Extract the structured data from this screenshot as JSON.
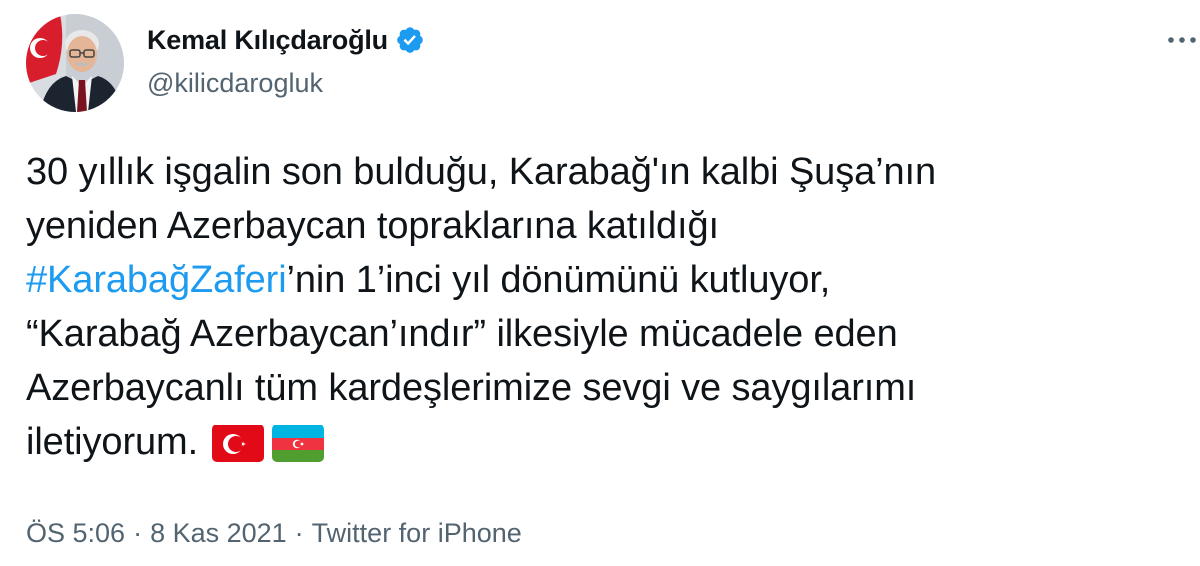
{
  "author": {
    "display_name": "Kemal Kılıçdaroğlu",
    "handle": "@kilicdarogluk",
    "verified": true,
    "avatar_icon": "profile-photo",
    "verified_icon": "verified-badge-icon"
  },
  "more_icon": "more-options-icon",
  "tweet": {
    "line1": "30 yıllık işgalin son bulduğu, Karabağ'ın kalbi Şuşa’nın",
    "line2": "yeniden Azerbaycan topraklarına katıldığı",
    "hashtag": "#KarabağZaferi",
    "line3_rest": "’nin 1’inci yıl dönümünü kutluyor,",
    "line4": "“Karabağ Azerbaycan’ındır” ilkesiyle mücadele eden",
    "line5": "Azerbaycanlı tüm kardeşlerimize sevgi ve saygılarımı",
    "line6": "iletiyorum.",
    "emoji": [
      "turkey-flag",
      "azerbaijan-flag"
    ]
  },
  "meta": {
    "time": "ÖS 5:06",
    "separator": "·",
    "date": "8 Kas 2021",
    "source": "Twitter for iPhone"
  },
  "colors": {
    "text": "#0f1419",
    "secondary": "#536471",
    "link": "#1d9bf0",
    "verified": "#1d9bf0"
  }
}
